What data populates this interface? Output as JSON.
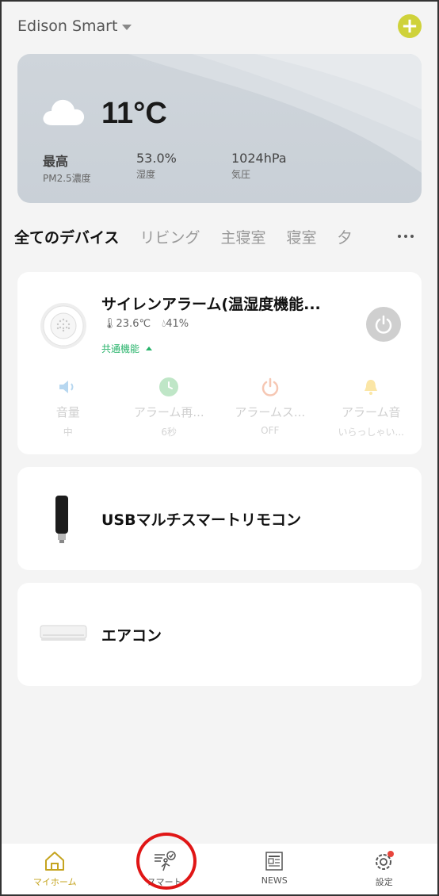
{
  "header": {
    "home_name": "Edison Smart",
    "add_icon": "plus-circle-icon",
    "accent": "#cfd23a"
  },
  "weather": {
    "condition_icon": "cloud-icon",
    "temperature": "11°C",
    "stats": [
      {
        "value": "最高",
        "label": "PM2.5濃度"
      },
      {
        "value": "53.0%",
        "label": "湿度"
      },
      {
        "value": "1024hPa",
        "label": "気圧"
      }
    ]
  },
  "tabs": [
    "全てのデバイス",
    "リビング",
    "主寝室",
    "寝室",
    "夕"
  ],
  "devices": [
    {
      "name": "サイレンアラーム(温湿度機能...",
      "temperature": "23.6℃",
      "humidity": "41%",
      "common_label": "共通機能",
      "functions": [
        {
          "icon": "speaker-icon",
          "label": "音量",
          "value": "中"
        },
        {
          "icon": "clock-icon",
          "label": "アラーム再...",
          "value": "6秒"
        },
        {
          "icon": "power-icon",
          "label": "アラームス...",
          "value": "OFF"
        },
        {
          "icon": "bell-icon",
          "label": "アラーム音",
          "value": "いらっしゃい..."
        }
      ]
    },
    {
      "name": "USBマルチスマートリモコン"
    },
    {
      "name": "エアコン"
    }
  ],
  "nav": [
    {
      "icon": "home-icon",
      "label": "マイホーム",
      "active": true
    },
    {
      "icon": "smart-scene-icon",
      "label": "スマート",
      "active": false
    },
    {
      "icon": "news-icon",
      "label": "NEWS",
      "active": false
    },
    {
      "icon": "gear-icon",
      "label": "設定",
      "active": false
    }
  ],
  "colors": {
    "active_nav": "#c5a41f",
    "common_green": "#27b36a",
    "highlight_circle": "#e01616"
  }
}
